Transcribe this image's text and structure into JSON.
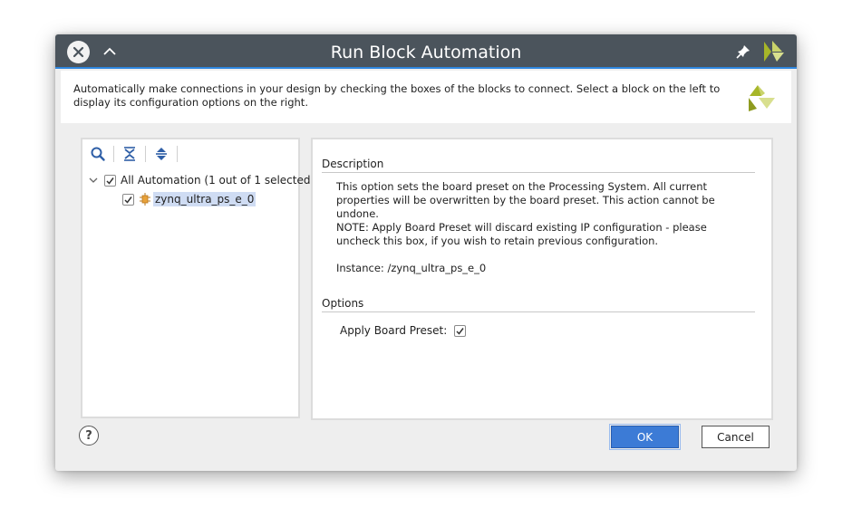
{
  "window": {
    "title": "Run Block Automation"
  },
  "banner": {
    "text": "Automatically make connections in your design by checking the boxes of the blocks to connect. Select a block on the left to display its configuration options on the right."
  },
  "tree": {
    "root": {
      "label": "All Automation (1 out of 1 selected)",
      "checked": true,
      "expanded": true
    },
    "children": [
      {
        "label": "zynq_ultra_ps_e_0",
        "checked": true,
        "selected": true
      }
    ]
  },
  "details": {
    "description_heading": "Description",
    "description_p1": "This option sets the board preset on the Processing System. All current properties will be overwritten by the board preset. This action cannot be undone.",
    "description_p2": "NOTE: Apply Board Preset will discard existing IP configuration - please uncheck this box, if you wish to retain previous configuration.",
    "instance": "Instance: /zynq_ultra_ps_e_0",
    "options_heading": "Options",
    "apply_board_preset_label": "Apply Board Preset:",
    "apply_board_preset_checked": true
  },
  "buttons": {
    "help": "?",
    "ok": "OK",
    "cancel": "Cancel"
  },
  "colors": {
    "titlebar": "#4b545c",
    "accent": "#3c7bd6",
    "selection": "#cfdcf3",
    "logo": "#a7b628"
  },
  "icons": {
    "close": "close-icon",
    "collapse": "chevron-up-icon",
    "pin": "pin-icon",
    "logo": "xilinx-logo-icon",
    "search": "search-icon",
    "collapse_all": "collapse-all-icon",
    "expand_all": "expand-all-icon",
    "tree_expander": "chevron-down-icon",
    "ip_block": "chip-icon"
  }
}
